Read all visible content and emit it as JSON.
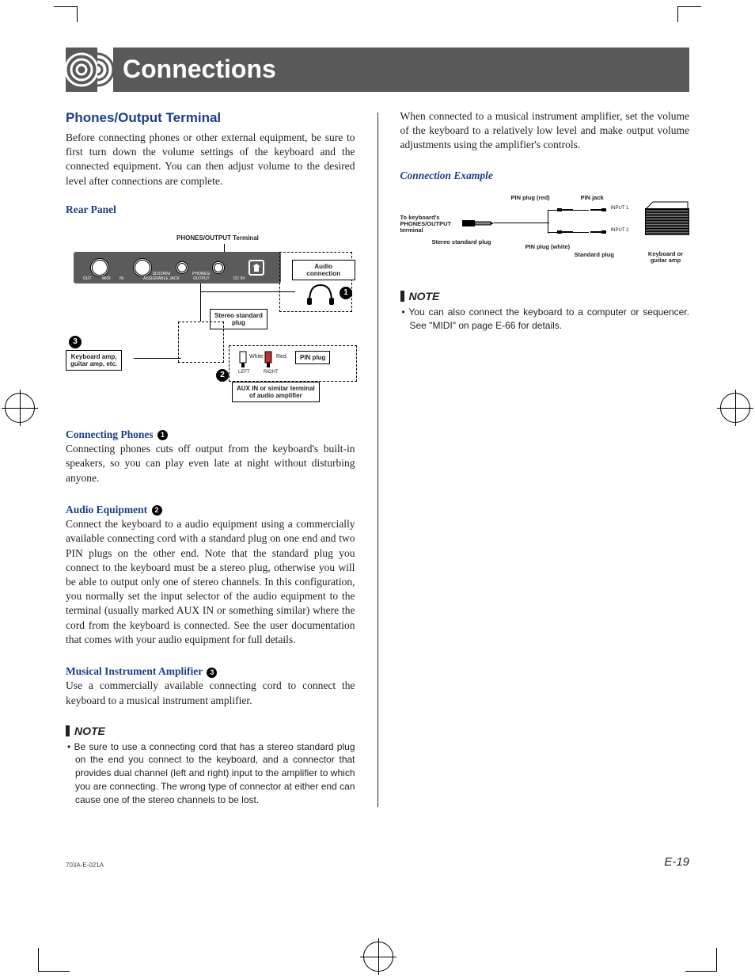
{
  "title": "Connections",
  "left": {
    "section_title": "Phones/Output Terminal",
    "intro": "Before connecting phones or other external equipment, be sure to first turn down the volume settings of the keyboard and the connected equipment. You can then adjust volume to the desired level after connections are complete.",
    "rear_panel": "Rear Panel",
    "diagram1": {
      "terminal_label": "PHONES/OUTPUT Terminal",
      "panel_labels": {
        "out": "OUT",
        "midi": "MIDI",
        "in": "IN",
        "sustain": "SUSTAIN/\nASSIGNABLE JACK",
        "phones": "PHONES/\nOUTPUT",
        "dc": "DC 9V"
      },
      "audio_connection": "Audio connection",
      "stereo_plug": "Stereo standard\nplug",
      "kb_amp": "Keyboard amp,\nguitar amp, etc.",
      "white": "White",
      "red": "Red",
      "pin_plug": "PIN plug",
      "left": "LEFT",
      "right": "RIGHT",
      "aux": "AUX IN or similar terminal\nof audio amplifier",
      "n1": "1",
      "n2": "2",
      "n3": "3"
    },
    "sub1_head": "Connecting Phones",
    "sub1_body": "Connecting phones cuts off output from the keyboard's built-in speakers, so you can play even late at night without disturbing anyone.",
    "sub2_head": "Audio Equipment",
    "sub2_body": "Connect the keyboard to a audio equipment using a commercially available connecting cord with a standard plug on one end and two PIN plugs on the other end. Note that the standard plug you connect to the keyboard must be a stereo plug, otherwise you will be able to output only one of stereo channels. In this configuration, you normally set the input selector of the audio equipment to the terminal (usually marked AUX IN or something similar) where the cord from the keyboard is connected. See the user documentation that comes with your audio equipment for full details.",
    "sub3_head": "Musical Instrument Amplifier",
    "sub3_body": "Use a commercially available connecting cord to connect the keyboard to a musical instrument amplifier.",
    "note_head": "NOTE",
    "note_body": "• Be sure to use a connecting cord that has a stereo standard plug on the end you connect to the keyboard, and a connector that provides dual channel (left and right) input to the amplifier to which you are connecting. The wrong type of connector at either end can cause one of the stereo channels to be lost."
  },
  "right": {
    "intro": "When connected to a musical instrument amplifier, set the volume of the keyboard to a relatively low level and make output volume adjustments using the amplifier's controls.",
    "example_title": "Connection Example",
    "diagram2": {
      "to_keyboard": "To keyboard's\nPHONES/OUTPUT\nterminal",
      "stereo_std": "Stereo standard plug",
      "pin_red": "PIN plug (red)",
      "pin_jack": "PIN jack",
      "pin_white": "PIN plug (white)",
      "std_plug": "Standard plug",
      "amp_label": "Keyboard or\nguitar amp",
      "in1": "INPUT 1",
      "in2": "INPUT 2"
    },
    "note_head": "NOTE",
    "note_body": "• You can also connect the keyboard to a computer or sequencer. See \"MIDI\" on page E-66 for details."
  },
  "footer": {
    "code": "703A-E-021A",
    "page": "E-19"
  }
}
